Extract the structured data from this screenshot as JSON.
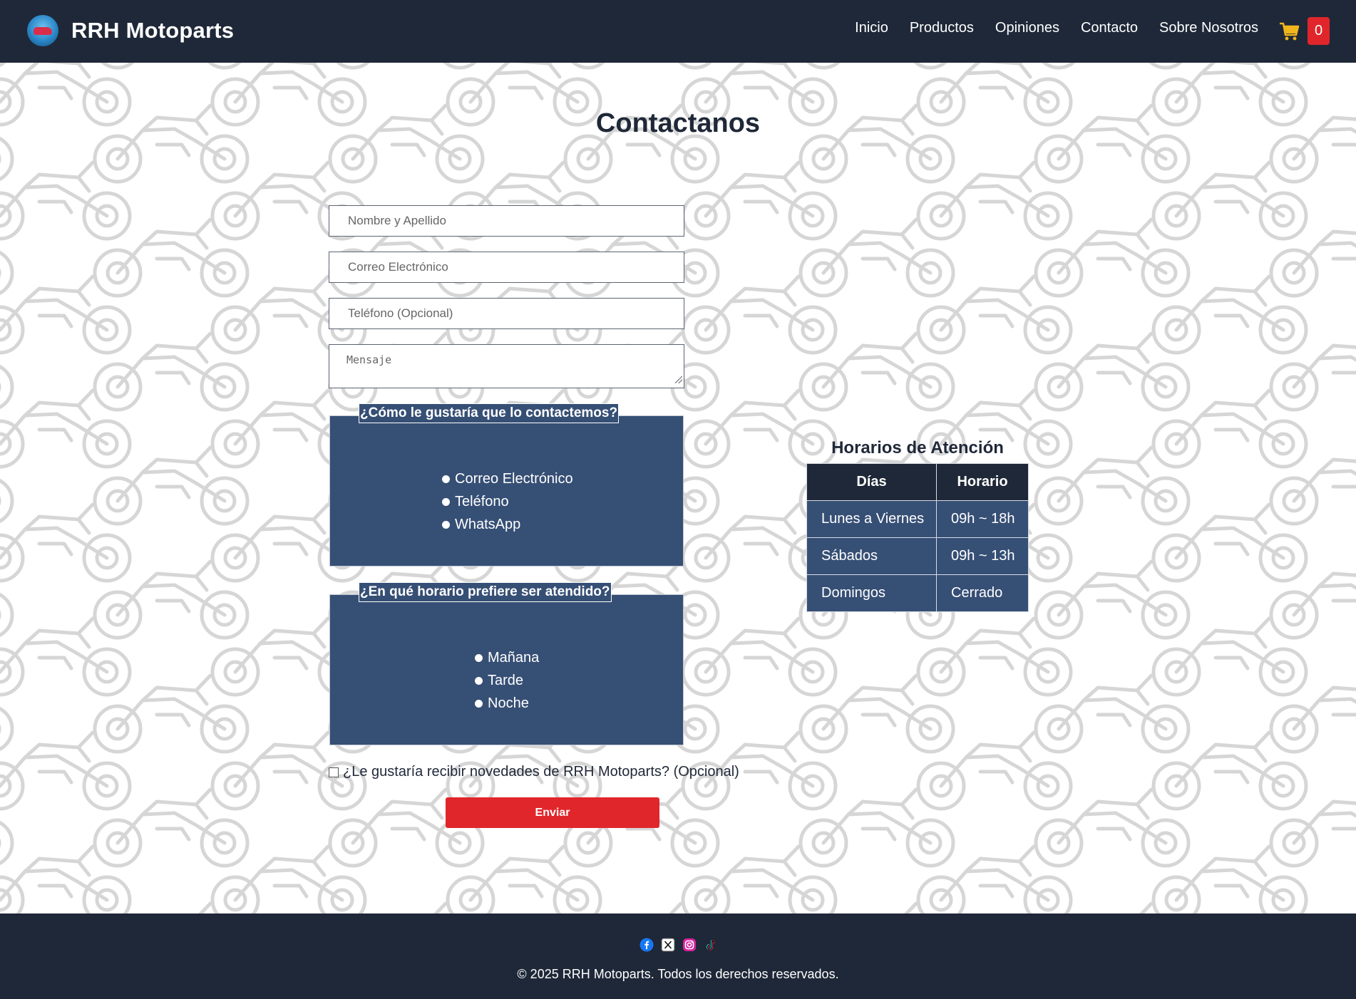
{
  "nav": {
    "brand": "RRH Motoparts",
    "links": [
      "Inicio",
      "Productos",
      "Opiniones",
      "Contacto",
      "Sobre Nosotros"
    ],
    "cart_count": "0"
  },
  "contact": {
    "title": "Contactanos",
    "name_placeholder": "Nombre y Apellido",
    "email_placeholder": "Correo Electrónico",
    "phone_placeholder": "Teléfono (Opcional)",
    "message_placeholder": "Mensaje",
    "method": {
      "legend": "¿Cómo le gustaría que lo contactemos?",
      "options": [
        "Correo Electrónico",
        "Teléfono",
        "WhatsApp"
      ]
    },
    "time": {
      "legend": "¿En qué horario prefiere ser atendido?",
      "options": [
        "Mañana",
        "Tarde",
        "Noche"
      ]
    },
    "newsletter_label": "¿Le gustaría recibir novedades de RRH Motoparts? (Opcional)",
    "submit_label": "Enviar"
  },
  "schedule": {
    "title": "Horarios de Atención",
    "headers": [
      "Días",
      "Horario"
    ],
    "rows": [
      [
        "Lunes a Viernes",
        "09h ~ 18h"
      ],
      [
        "Sábados",
        "09h ~ 13h"
      ],
      [
        "Domingos",
        "Cerrado"
      ]
    ]
  },
  "footer": {
    "socials": [
      "facebook-icon",
      "x-icon",
      "instagram-icon",
      "tiktok-icon"
    ],
    "copyright": "© 2025 RRH Motoparts. Todos los derechos reservados."
  },
  "colors": {
    "nav": "#1f2838",
    "panel": "#364f75",
    "accent": "#e0262b"
  }
}
